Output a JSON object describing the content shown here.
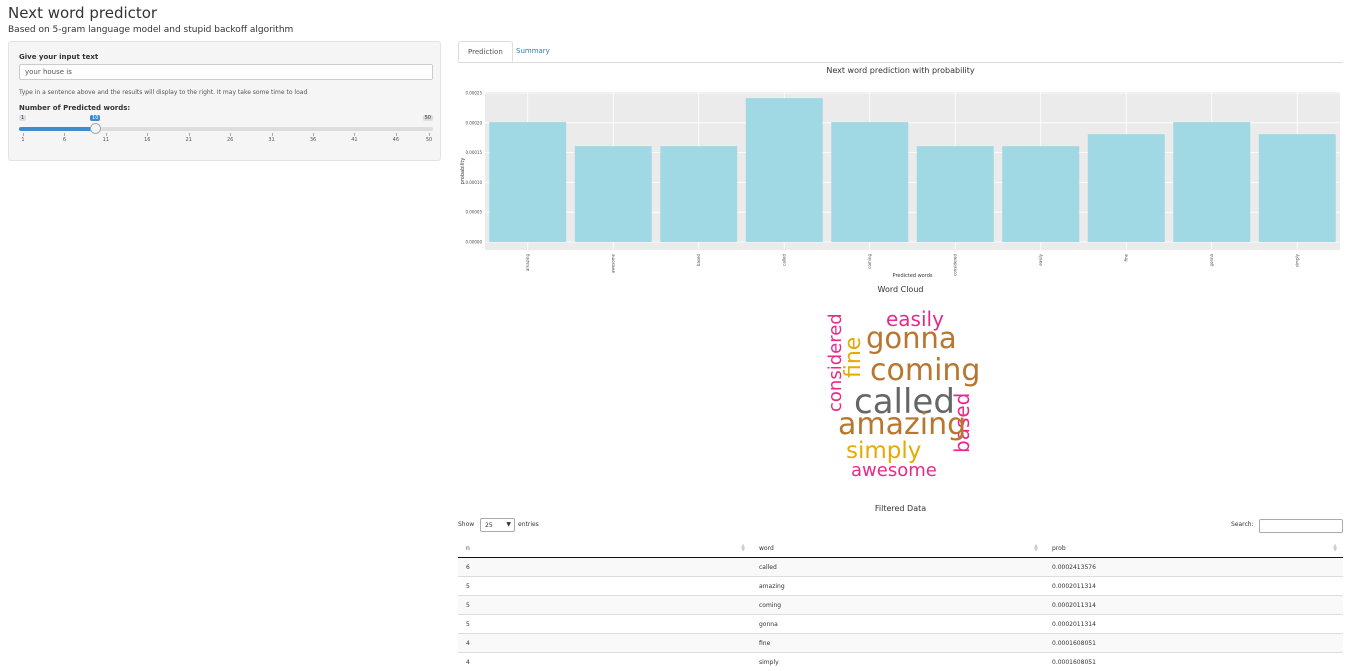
{
  "app": {
    "title": "Next word predictor",
    "subtitle": "Based on 5-gram language model and stupid backoff algorithm"
  },
  "sidebar": {
    "input_label": "Give your input text",
    "input_value": "your house is",
    "help_text": "Type in a sentence above and the results will display to the right. It may take some time to load",
    "slider_label": "Number of Predicted words:",
    "slider": {
      "min": 1,
      "max": 50,
      "value": 10,
      "min_label": "1",
      "max_label": "50",
      "value_label": "10",
      "grid_labels": [
        "1",
        "6",
        "11",
        "16",
        "21",
        "26",
        "31",
        "36",
        "41",
        "46",
        "50"
      ],
      "accent": "#428bca"
    }
  },
  "tabs": [
    {
      "label": "Prediction",
      "active": true
    },
    {
      "label": "Summary",
      "active": false
    }
  ],
  "chart_data": {
    "type": "bar",
    "title": "Next word prediction with probability",
    "xlabel": "Predicted words",
    "ylabel": "probability",
    "categories": [
      "amazing",
      "awesome",
      "based",
      "called",
      "coming",
      "considered",
      "easily",
      "fine",
      "gonna",
      "simply"
    ],
    "values": [
      0.0002011314,
      0.0001608051,
      0.0001608051,
      0.0002413576,
      0.0002011314,
      0.0001608051,
      0.0001608051,
      0.0001809051,
      0.0002011314,
      0.0001809051
    ],
    "yticks": [
      "0.00000",
      "0.00005",
      "0.00010",
      "0.00015",
      "0.00020",
      "0.00025"
    ],
    "ylim": [
      0,
      0.00025
    ],
    "bar_color": "#a0d8e3",
    "panel_color": "#ebebeb",
    "grid": true
  },
  "wordcloud": {
    "title": "Word Cloud",
    "words": [
      {
        "text": "easily",
        "color": "#e7298a"
      },
      {
        "text": "gonna",
        "color": "#b8762f"
      },
      {
        "text": "fine",
        "color": "#e6ab02"
      },
      {
        "text": "considered",
        "color": "#e7298a"
      },
      {
        "text": "coming",
        "color": "#b8762f"
      },
      {
        "text": "called",
        "color": "#666666"
      },
      {
        "text": "based",
        "color": "#e7298a"
      },
      {
        "text": "amazing",
        "color": "#b8762f"
      },
      {
        "text": "simply",
        "color": "#e6ab02"
      },
      {
        "text": "awesome",
        "color": "#e7298a"
      }
    ]
  },
  "table": {
    "title": "Filtered Data",
    "show_label": "Show",
    "page_length": "25",
    "entries_label": "entries",
    "search_label": "Search:",
    "columns": [
      "n",
      "word",
      "prob"
    ],
    "rows": [
      [
        "6",
        "called",
        "0.0002413576"
      ],
      [
        "5",
        "amazing",
        "0.0002011314"
      ],
      [
        "5",
        "coming",
        "0.0002011314"
      ],
      [
        "5",
        "gonna",
        "0.0002011314"
      ],
      [
        "4",
        "fine",
        "0.0001608051"
      ],
      [
        "4",
        "simply",
        "0.0001608051"
      ]
    ]
  }
}
